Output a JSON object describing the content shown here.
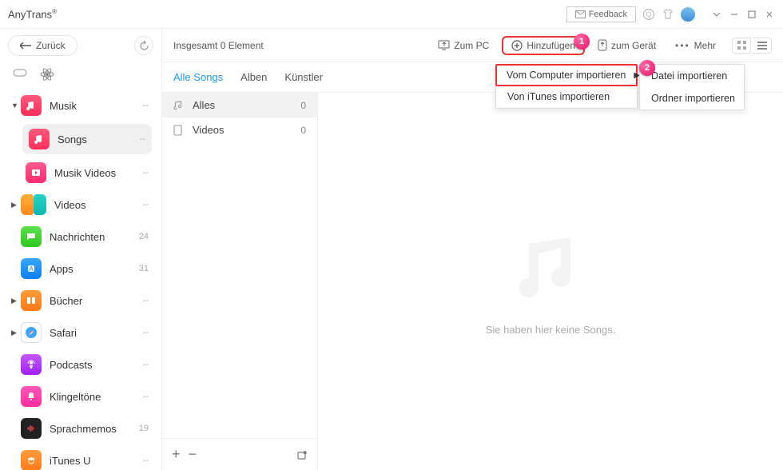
{
  "app_name": "AnyTrans",
  "header": {
    "feedback": "Feedback"
  },
  "sidebar": {
    "back": "Zurück",
    "items": [
      {
        "label": "Musik",
        "count": "--",
        "expandable": true,
        "expanded": true
      },
      {
        "label": "Songs",
        "count": "--",
        "child": true,
        "selected": true
      },
      {
        "label": "Musik Videos",
        "count": "--",
        "child": true
      },
      {
        "label": "Videos",
        "count": "--",
        "expandable": true
      },
      {
        "label": "Nachrichten",
        "count": "24"
      },
      {
        "label": "Apps",
        "count": "31"
      },
      {
        "label": "Bücher",
        "count": "--",
        "expandable": true
      },
      {
        "label": "Safari",
        "count": "--",
        "expandable": true
      },
      {
        "label": "Podcasts",
        "count": "--"
      },
      {
        "label": "Klingeltöne",
        "count": "--"
      },
      {
        "label": "Sprachmemos",
        "count": "19"
      },
      {
        "label": "iTunes U",
        "count": "--"
      }
    ]
  },
  "toolbar": {
    "summary": "Insgesamt 0 Element",
    "to_pc": "Zum PC",
    "add": "Hinzufügen",
    "to_device": "zum Gerät",
    "more": "Mehr"
  },
  "tabs": {
    "all_songs": "Alle Songs",
    "albums": "Alben",
    "artists": "Künstler"
  },
  "categories": [
    {
      "label": "Alles",
      "count": "0",
      "selected": true,
      "icon": "note"
    },
    {
      "label": "Videos",
      "count": "0",
      "icon": "device"
    }
  ],
  "empty_text": "Sie haben hier keine Songs.",
  "menu1": {
    "item1": "Vom Computer importieren",
    "item2": "Von iTunes importieren"
  },
  "menu2": {
    "item1": "Datei importieren",
    "item2": "Ordner importieren"
  },
  "badges": {
    "one": "1",
    "two": "2"
  }
}
